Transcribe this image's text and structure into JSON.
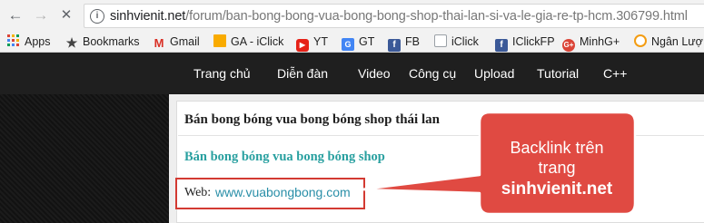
{
  "browser": {
    "url_host": "sinhvienit.net",
    "url_path": "/forum/ban-bong-bong-vua-bong-bong-shop-thai-lan-si-va-le-gia-re-tp-hcm.306799.html",
    "bookmarks": [
      {
        "label": "Apps",
        "icon": "apps-grid-icon"
      },
      {
        "label": "Bookmarks",
        "icon": "star-icon"
      },
      {
        "label": "Gmail",
        "icon": "gmail-icon"
      },
      {
        "label": "GA - iClick",
        "icon": "analytics-icon"
      },
      {
        "label": "YT",
        "icon": "youtube-icon"
      },
      {
        "label": "GT",
        "icon": "translate-icon"
      },
      {
        "label": "FB",
        "icon": "facebook-icon"
      },
      {
        "label": "iClick",
        "icon": "page-icon"
      },
      {
        "label": "IClickFP",
        "icon": "facebook-icon"
      },
      {
        "label": "MinhG+",
        "icon": "google-plus-icon"
      },
      {
        "label": "Ngân Lượ",
        "icon": "nganluong-icon"
      }
    ]
  },
  "site_nav": {
    "items": [
      "Trang chủ",
      "Diễn đàn",
      "Video",
      "Công cụ",
      "Upload",
      "Tutorial",
      "C++"
    ]
  },
  "post": {
    "title": "Bán bong bóng vua bong bóng shop thái lan",
    "subheading": "Bán bong bóng vua bong bóng shop",
    "web_label": "Web:",
    "web_link": "www.vuabongbong.com"
  },
  "callout": {
    "line1": "Backlink trên",
    "line2": "trang",
    "line3": "sinhvienit.net"
  },
  "colors": {
    "nav_bg": "#1f1f1f",
    "subheading": "#29a0a0",
    "link": "#2a8fa8",
    "callout_fill": "#e04a42",
    "callout_border": "#ffffff",
    "highlight_box": "#d33a32"
  }
}
